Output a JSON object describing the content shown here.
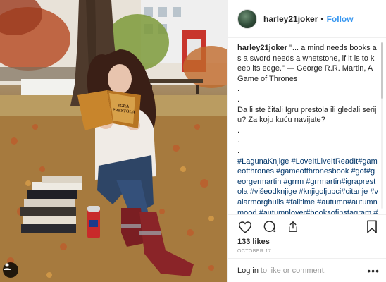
{
  "post": {
    "username": "harley21joker",
    "separator": "•",
    "follow_label": "Follow",
    "caption_user": "harley21joker",
    "caption_text": "\"... a mind needs books as a sword needs a whetstone, if it is to keep its edge.\" — George R.R. Martin, A Game of Thrones",
    "caption_dots_1": ".",
    "caption_dots_2": ".",
    "caption_question": "Da li ste čitali Igru prestola ili gledali seriju? Za koju kuću navijate?",
    "caption_dots_3": ".",
    "caption_dots_4": ".",
    "caption_dots_5": ".",
    "hashtags": "#LagunaKnjige #LoveItLiveItReadIt#gameofthrones #gameofthronesbook #got#georgermartin #grrm #grrmartin#igraprestola #višeodknjige #knjigoljupci#citanje #valarmorghulis #falltime #autumn#autumnmood #autumnlover#booksofinstagram #bookworm #booklover#bookaholic #bibliophile #bookish #ilovereading #booknerd #instaboo",
    "likes": "133 likes",
    "date": "OCTOBER 17",
    "login_label": "Log in",
    "login_rest": "to like or comment.",
    "more_label": "•••"
  },
  "book": {
    "cover_text_1": "IGRA",
    "cover_text_2": "PRESTOLA"
  },
  "icons": {
    "heart": "heart-icon",
    "comment": "comment-icon",
    "share": "share-icon",
    "save": "bookmark-icon",
    "user_tag": "user-tag-icon",
    "follow_color": "#3897f0"
  }
}
